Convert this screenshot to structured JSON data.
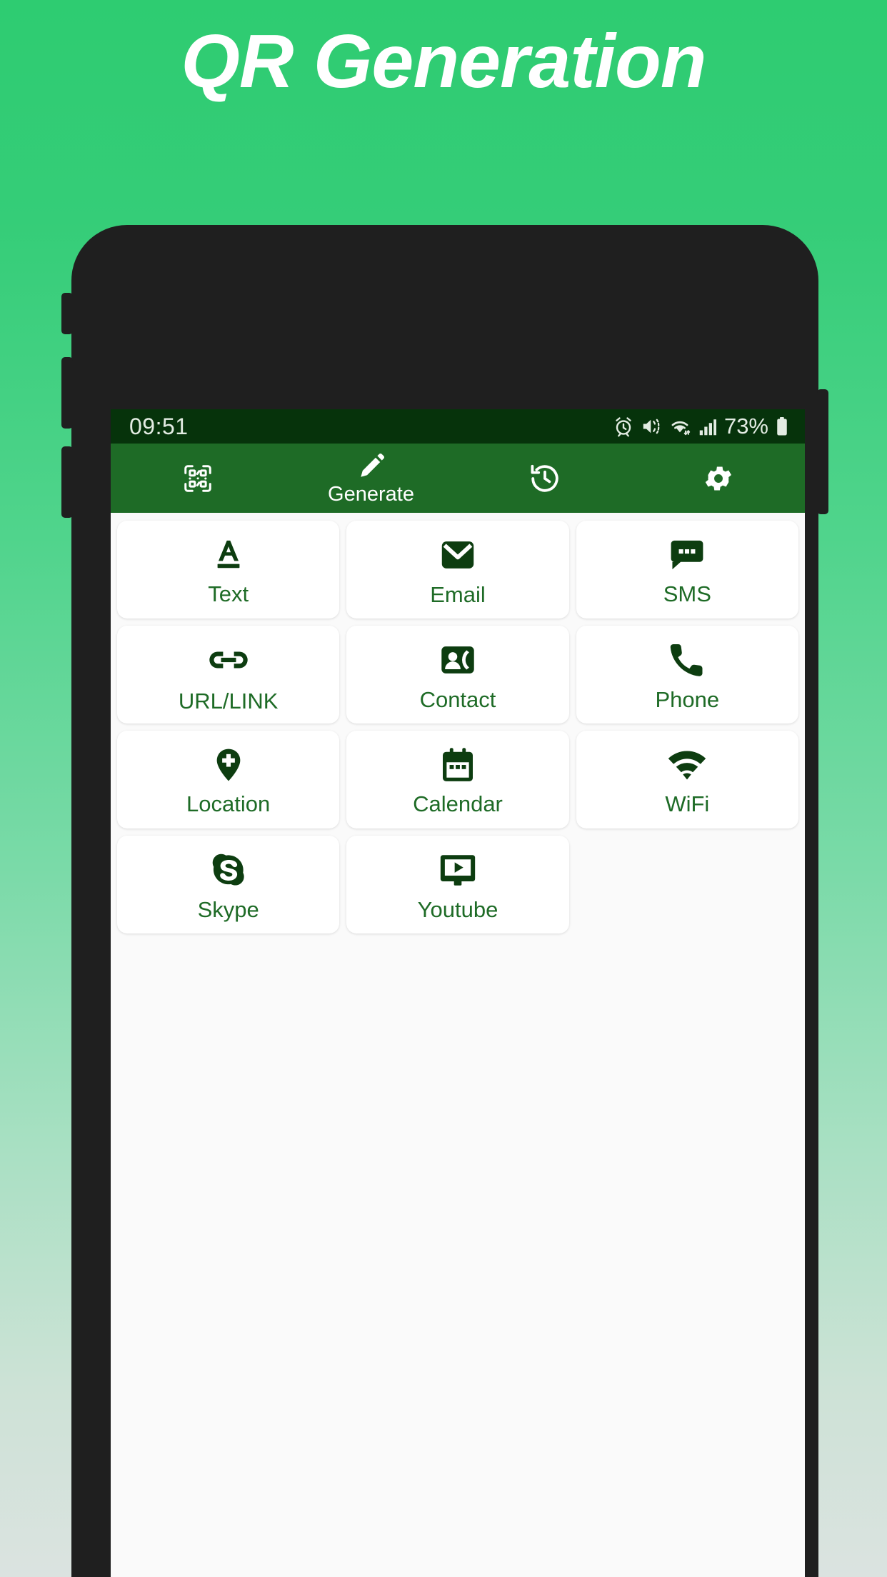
{
  "page": {
    "title": "QR Generation"
  },
  "statusbar": {
    "time": "09:51",
    "battery_percent": "73%",
    "icons": [
      "alarm-icon",
      "mute-vibrate-icon",
      "wifi-icon",
      "signal-bars-icon",
      "battery-icon"
    ]
  },
  "toolbar": {
    "background": "#1e6b26",
    "items": [
      {
        "icon": "qr-scan-icon",
        "label": ""
      },
      {
        "icon": "pencil-icon",
        "label": "Generate"
      },
      {
        "icon": "history-icon",
        "label": ""
      },
      {
        "icon": "gear-icon",
        "label": ""
      }
    ]
  },
  "grid": {
    "accent": "#0d3d10",
    "label_color": "#1e6b26",
    "tiles": [
      {
        "label": "Text",
        "icon": "text-a-icon"
      },
      {
        "label": "Email",
        "icon": "envelope-icon"
      },
      {
        "label": "SMS",
        "icon": "chat-bubble-icon"
      },
      {
        "label": "URL/LINK",
        "icon": "link-chain-icon"
      },
      {
        "label": "Contact",
        "icon": "contact-card-icon"
      },
      {
        "label": "Phone",
        "icon": "phone-handset-icon"
      },
      {
        "label": "Location",
        "icon": "map-pin-plus-icon"
      },
      {
        "label": "Calendar",
        "icon": "calendar-icon"
      },
      {
        "label": "WiFi",
        "icon": "wifi-icon"
      },
      {
        "label": "Skype",
        "icon": "skype-icon"
      },
      {
        "label": "Youtube",
        "icon": "youtube-monitor-icon"
      }
    ]
  },
  "theme": {
    "bg_top": "#2ecc71",
    "bg_bottom": "#dbe3e0",
    "phone_body": "#1f1f1f",
    "statusbar_bg": "#06330b",
    "toolbar_bg": "#1e6b26",
    "icon_dark_green": "#0d3d10"
  }
}
